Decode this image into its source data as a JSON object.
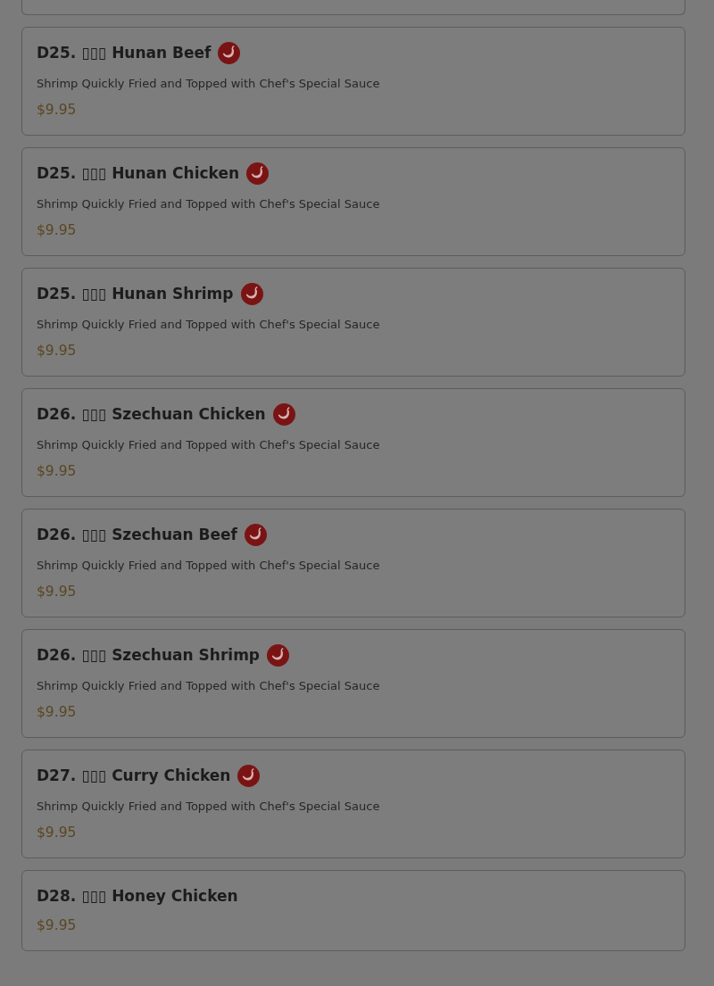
{
  "items": [
    {
      "name": "D25. ▯▯▯ Hunan Beef",
      "spicy": true,
      "description": "Shrimp Quickly Fried and Topped with Chef's Special Sauce",
      "price": "$9.95"
    },
    {
      "name": "D25. ▯▯▯ Hunan Chicken",
      "spicy": true,
      "description": "Shrimp Quickly Fried and Topped with Chef's Special Sauce",
      "price": "$9.95"
    },
    {
      "name": "D25. ▯▯▯ Hunan Shrimp",
      "spicy": true,
      "description": "Shrimp Quickly Fried and Topped with Chef's Special Sauce",
      "price": "$9.95"
    },
    {
      "name": "D26. ▯▯▯ Szechuan Chicken",
      "spicy": true,
      "description": "Shrimp Quickly Fried and Topped with Chef's Special Sauce",
      "price": "$9.95"
    },
    {
      "name": "D26. ▯▯▯ Szechuan Beef",
      "spicy": true,
      "description": "Shrimp Quickly Fried and Topped with Chef's Special Sauce",
      "price": "$9.95"
    },
    {
      "name": "D26. ▯▯▯ Szechuan Shrimp",
      "spicy": true,
      "description": "Shrimp Quickly Fried and Topped with Chef's Special Sauce",
      "price": "$9.95"
    },
    {
      "name": "D27. ▯▯▯ Curry Chicken",
      "spicy": true,
      "description": "Shrimp Quickly Fried and Topped with Chef's Special Sauce",
      "price": "$9.95"
    },
    {
      "name": "D28. ▯▯▯ Honey Chicken",
      "spicy": false,
      "price": "$9.95"
    }
  ]
}
